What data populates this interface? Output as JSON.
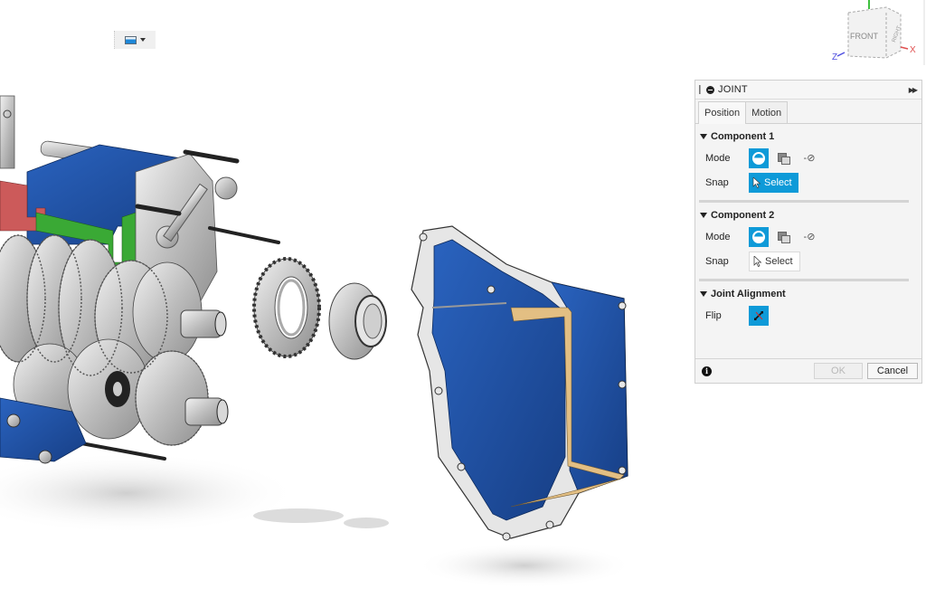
{
  "viewport": {
    "background": "#ffffff",
    "model": "exploded gearbox assembly with separated gear, bearing and cover housing",
    "colors": {
      "housing_blue": "#1f4e9c",
      "section_green": "#3aa935",
      "section_red": "#cc5a5a",
      "metal": "#c8c8c8",
      "cut_face": "#e3bf83"
    }
  },
  "mini_toolbar": {
    "display_icon": "display-settings-icon",
    "dropdown_icon": "caret-down-icon"
  },
  "viewcube": {
    "face_front": "FRONT",
    "face_right": "RIGHT",
    "axis_x": "X",
    "axis_z": "Z",
    "colors": {
      "x": "#e05050",
      "y": "#40c040",
      "z": "#5050e0"
    }
  },
  "panel": {
    "title": "JOINT",
    "tabs": [
      {
        "label": "Position",
        "active": true
      },
      {
        "label": "Motion",
        "active": false
      }
    ],
    "sections": [
      {
        "title": "Component 1",
        "mode_label": "Mode",
        "snap_label": "Snap",
        "select_label": "Select",
        "select_active": true
      },
      {
        "title": "Component 2",
        "mode_label": "Mode",
        "snap_label": "Snap",
        "select_label": "Select",
        "select_active": false
      },
      {
        "title": "Joint Alignment",
        "flip_label": "Flip"
      }
    ],
    "ok_label": "OK",
    "cancel_label": "Cancel",
    "accent": "#0e9ad8"
  }
}
